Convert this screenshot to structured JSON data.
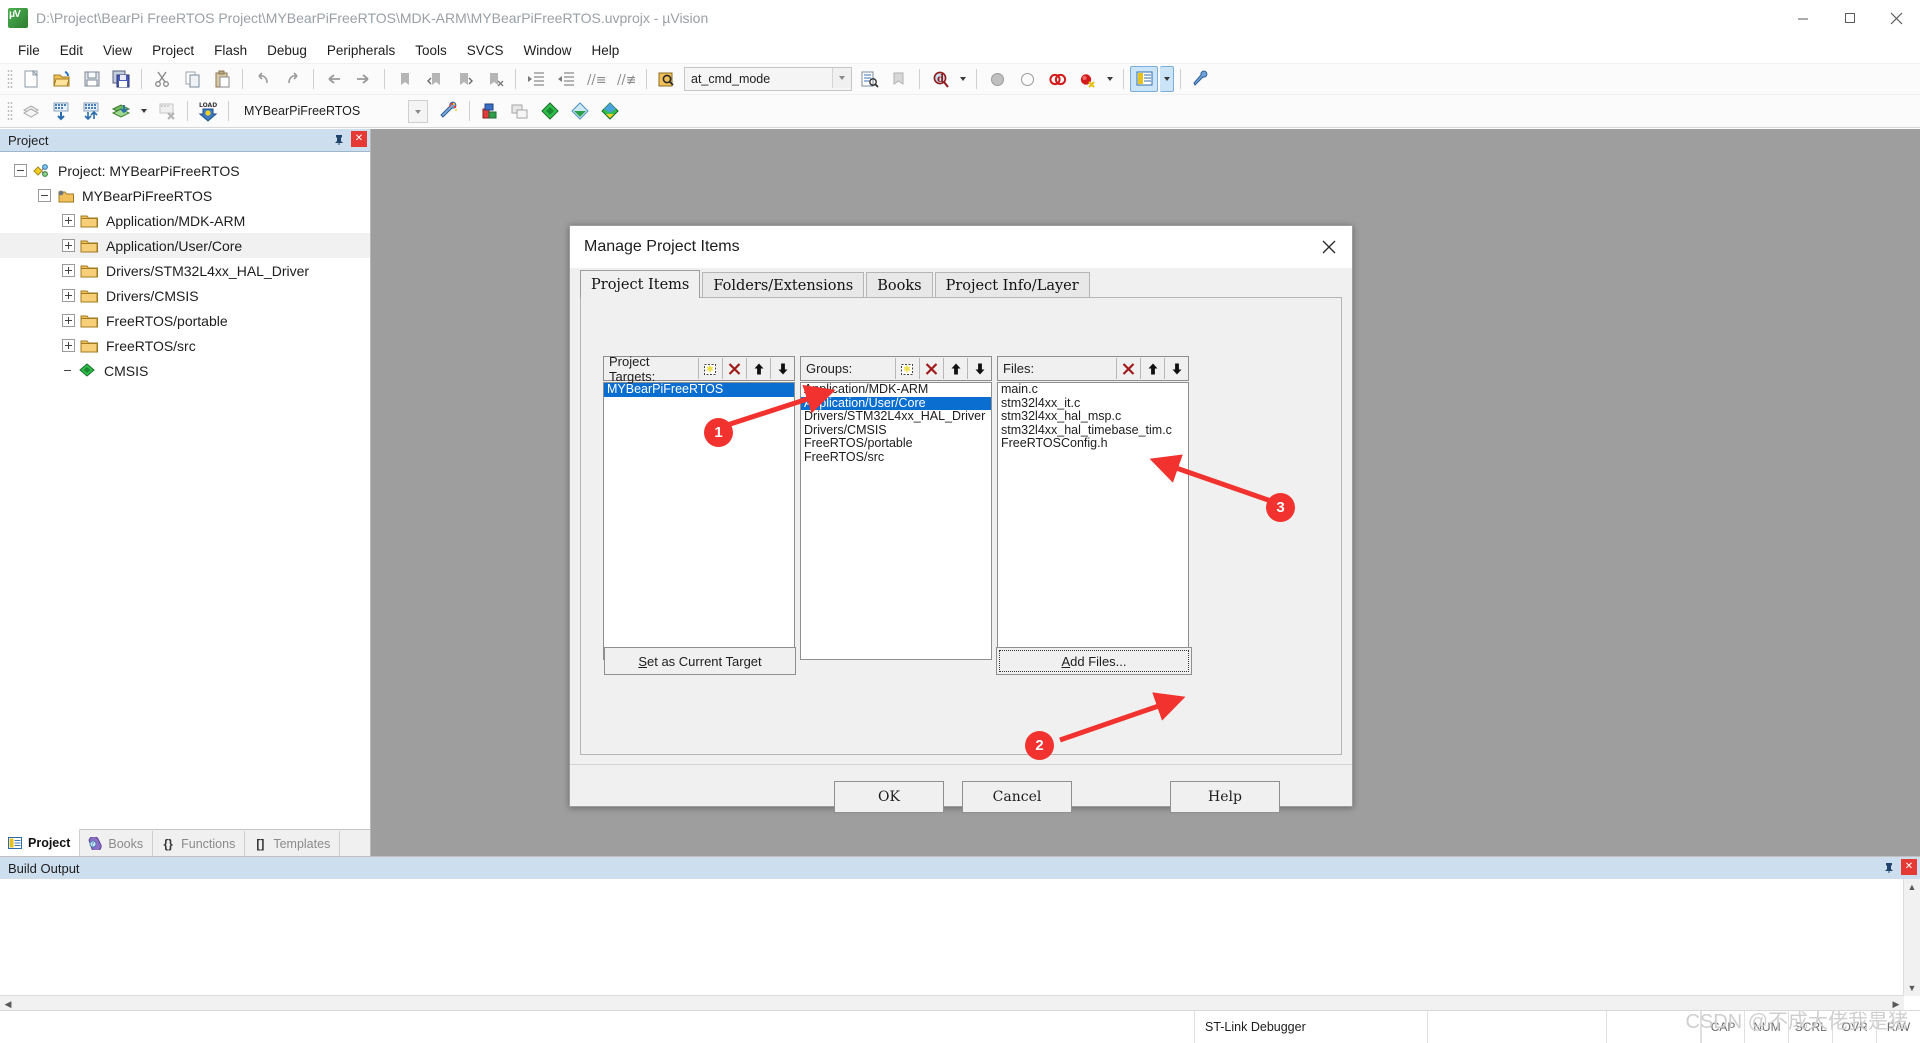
{
  "window": {
    "title": "D:\\Project\\BearPi FreeRTOS Project\\MYBearPiFreeRTOS\\MDK-ARM\\MYBearPiFreeRTOS.uvprojx - µVision",
    "app_icon": "uvision-icon",
    "minimize": "—",
    "maximize": "❐",
    "close": "✕"
  },
  "menu": {
    "items": [
      "File",
      "Edit",
      "View",
      "Project",
      "Flash",
      "Debug",
      "Peripherals",
      "Tools",
      "SVCS",
      "Window",
      "Help"
    ]
  },
  "toolbar1": {
    "combo_value": "at_cmd_mode",
    "icons": [
      "new-file-icon",
      "open-file-icon",
      "save-icon",
      "save-all-icon",
      "cut-icon",
      "copy-icon",
      "paste-icon",
      "undo-icon",
      "redo-icon",
      "back-icon",
      "forward-icon",
      "bookmark-toggle-icon",
      "bookmark-prev-icon",
      "bookmark-next-icon",
      "bookmark-clear-icon",
      "indent-icon",
      "outdent-icon",
      "comment-icon",
      "uncomment-icon",
      "find-in-files-icon",
      "find-icon",
      "insert-bookmark-icon",
      "search-icon",
      "start-debug-icon",
      "stop-debug-icon",
      "insert-breakpoint-icon",
      "kill-breakpoints-icon",
      "project-window-icon",
      "configure-icon"
    ]
  },
  "toolbar2": {
    "target_value": "MYBearPiFreeRTOS",
    "icons": [
      "translate-icon",
      "build-icon",
      "rebuild-icon",
      "batch-build-icon",
      "stop-build-icon",
      "load-icon",
      "target-options-icon",
      "manage-project-items-icon",
      "multi-project-icon",
      "pack-installer-icon",
      "rtx-icon",
      "configuration-wizard-icon"
    ]
  },
  "project_panel": {
    "caption": "Project",
    "pin_icon": "pin-icon",
    "close_icon": "close-icon",
    "tree": [
      {
        "label": "Project: MYBearPiFreeRTOS",
        "level": 0,
        "toggle": "minus",
        "icon": "project-icon",
        "selected": false
      },
      {
        "label": "MYBearPiFreeRTOS",
        "level": 1,
        "toggle": "minus",
        "icon": "target-icon",
        "selected": false
      },
      {
        "label": "Application/MDK-ARM",
        "level": 2,
        "toggle": "plus",
        "icon": "folder-icon",
        "selected": false
      },
      {
        "label": "Application/User/Core",
        "level": 2,
        "toggle": "plus",
        "icon": "folder-icon",
        "selected": true
      },
      {
        "label": "Drivers/STM32L4xx_HAL_Driver",
        "level": 2,
        "toggle": "plus",
        "icon": "folder-icon",
        "selected": false
      },
      {
        "label": "Drivers/CMSIS",
        "level": 2,
        "toggle": "plus",
        "icon": "folder-icon",
        "selected": false
      },
      {
        "label": "FreeRTOS/portable",
        "level": 2,
        "toggle": "plus",
        "icon": "folder-icon",
        "selected": false
      },
      {
        "label": "FreeRTOS/src",
        "level": 2,
        "toggle": "plus",
        "icon": "folder-icon",
        "selected": false
      },
      {
        "label": "CMSIS",
        "level": 2,
        "toggle": "none",
        "icon": "cmsis-icon",
        "selected": false
      }
    ],
    "view_tabs": [
      {
        "label": "Project",
        "icon": "project-tab-icon",
        "active": true
      },
      {
        "label": "Books",
        "icon": "books-tab-icon",
        "active": false
      },
      {
        "label": "Functions",
        "icon": "functions-tab-icon",
        "active": false
      },
      {
        "label": "Templates",
        "icon": "templates-tab-icon",
        "active": false
      }
    ]
  },
  "build_output": {
    "caption": "Build Output",
    "pin_icon": "pin-icon",
    "close_icon": "close-icon",
    "content": ""
  },
  "status_bar": {
    "debugger": "ST-Link Debugger",
    "indicators": [
      "CAP",
      "NUM",
      "SCRL",
      "OVR",
      "R/W"
    ],
    "watermark": "CSDN @不成大佬我是猪"
  },
  "dialog": {
    "title": "Manage Project Items",
    "close_icon": "close-icon",
    "tabs": [
      {
        "label": "Project Items",
        "active": true
      },
      {
        "label": "Folders/Extensions",
        "active": false
      },
      {
        "label": "Books",
        "active": false
      },
      {
        "label": "Project Info/Layer",
        "active": false
      }
    ],
    "targets": {
      "label": "Project Targets:",
      "buttons": [
        "new-item-icon",
        "delete-icon",
        "move-up-icon",
        "move-down-icon"
      ],
      "items": [
        {
          "label": "MYBearPiFreeRTOS",
          "selected": true
        }
      ]
    },
    "groups": {
      "label": "Groups:",
      "buttons": [
        "new-item-icon",
        "delete-icon",
        "move-up-icon",
        "move-down-icon"
      ],
      "items": [
        {
          "label": "Application/MDK-ARM",
          "selected": false
        },
        {
          "label": "Application/User/Core",
          "selected": true
        },
        {
          "label": "Drivers/STM32L4xx_HAL_Driver",
          "selected": false
        },
        {
          "label": "Drivers/CMSIS",
          "selected": false
        },
        {
          "label": "FreeRTOS/portable",
          "selected": false
        },
        {
          "label": "FreeRTOS/src",
          "selected": false
        }
      ]
    },
    "files": {
      "label": "Files:",
      "buttons": [
        "delete-icon",
        "move-up-icon",
        "move-down-icon"
      ],
      "items": [
        {
          "label": "main.c",
          "selected": false
        },
        {
          "label": "stm32l4xx_it.c",
          "selected": false
        },
        {
          "label": "stm32l4xx_hal_msp.c",
          "selected": false
        },
        {
          "label": "stm32l4xx_hal_timebase_tim.c",
          "selected": false
        },
        {
          "label": "FreeRTOSConfig.h",
          "selected": false
        }
      ]
    },
    "set_current_target": "Set as Current Target",
    "add_files": "Add Files...",
    "ok": "OK",
    "cancel": "Cancel",
    "help": "Help"
  },
  "callouts": [
    {
      "number": "1"
    },
    {
      "number": "2"
    },
    {
      "number": "3"
    }
  ],
  "colors": {
    "selection_blue": "#0a6ed1",
    "callout_red": "#f2322e",
    "panel_caption": "#cddeee",
    "workspace_grey": "#9e9e9e"
  }
}
